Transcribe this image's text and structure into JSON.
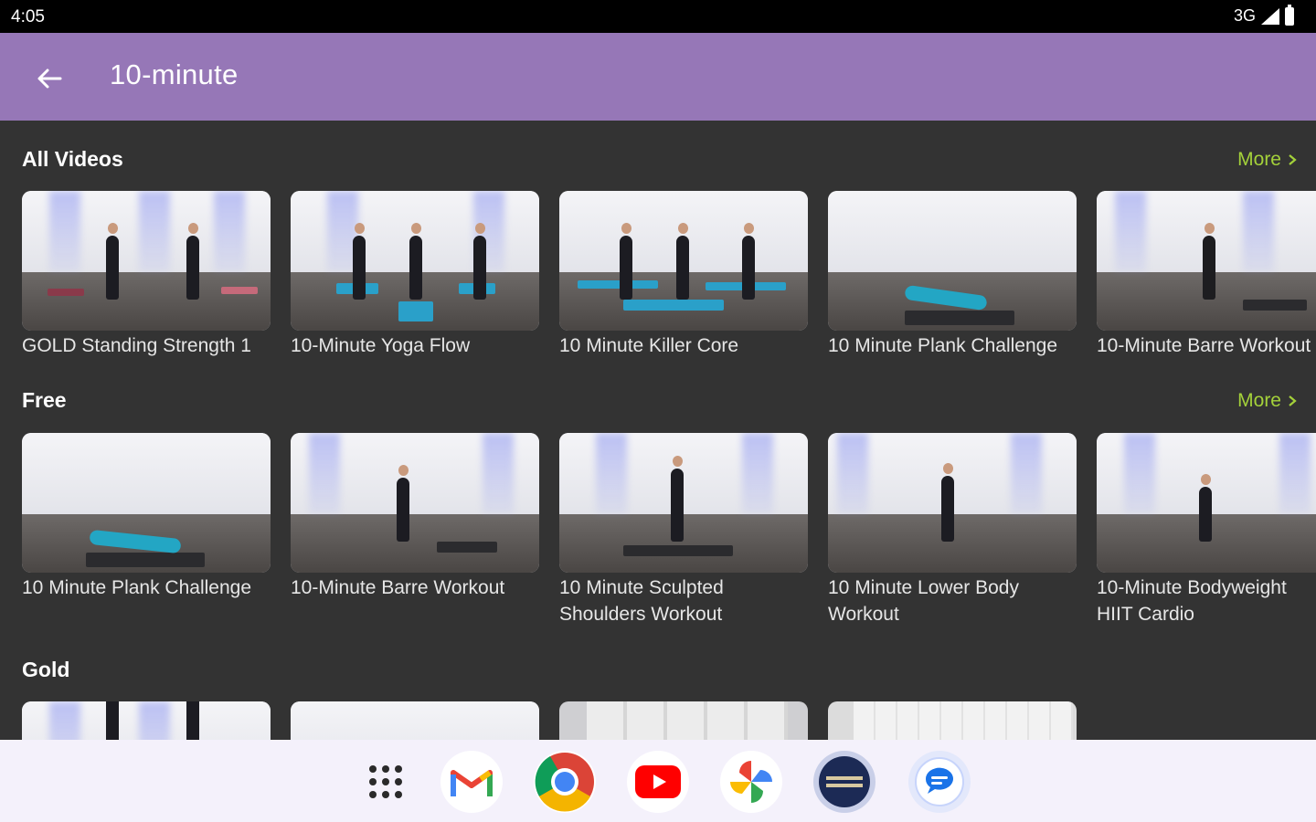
{
  "status_bar": {
    "time": "4:05",
    "network": "3G"
  },
  "app_bar": {
    "title": "10-minute"
  },
  "sections": [
    {
      "title": "All Videos",
      "more": "More",
      "videos": [
        "GOLD Standing Strength 1",
        "10-Minute Yoga Flow",
        "10 Minute Killer Core",
        "10 Minute Plank Challenge",
        "10-Minute Barre Workout"
      ]
    },
    {
      "title": "Free",
      "more": "More",
      "videos": [
        "10 Minute Plank Challenge",
        "10-Minute Barre Workout",
        "10 Minute Sculpted Shoulders Workout",
        "10 Minute Lower Body Workout",
        "10-Minute Bodyweight HIIT Cardio"
      ]
    },
    {
      "title": "Gold",
      "videos": [
        "",
        "",
        "",
        ""
      ]
    }
  ],
  "dock": [
    "apps-grid-icon",
    "gmail-icon",
    "chrome-icon",
    "youtube-icon",
    "photos-icon",
    "fitness-app-icon",
    "messages-icon"
  ],
  "colors": {
    "app_bar": "#9677b7",
    "background": "#333333",
    "more_link": "#a4d13a"
  }
}
